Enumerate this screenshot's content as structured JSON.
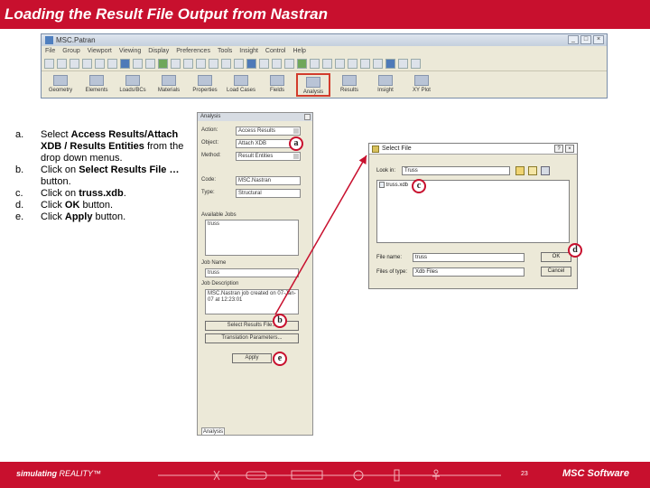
{
  "slide_title": "Loading the Result File Output from Nastran",
  "patran_window": {
    "title": "MSC.Patran",
    "menu": [
      "File",
      "Group",
      "Viewport",
      "Viewing",
      "Display",
      "Preferences",
      "Tools",
      "Insight",
      "Control",
      "Help"
    ],
    "app_buttons": [
      "Geometry",
      "Elements",
      "Loads/BCs",
      "Materials",
      "Properties",
      "Load Cases",
      "Fields",
      "Analysis",
      "Results",
      "Insight",
      "XY Plot"
    ],
    "selected_app": "Analysis",
    "selected_color": "#d23c2c"
  },
  "instructions": [
    {
      "letter": "a.",
      "text_parts": [
        {
          "t": "Select ",
          "b": false
        },
        {
          "t": "Access Results/Attach XDB / Results Entities",
          "b": true
        },
        {
          "t": " from the drop down menus.",
          "b": false
        }
      ]
    },
    {
      "letter": "b.",
      "text_parts": [
        {
          "t": "Click on ",
          "b": false
        },
        {
          "t": "Select Results File …",
          "b": true
        },
        {
          "t": " button.",
          "b": false
        }
      ]
    },
    {
      "letter": "c.",
      "text_parts": [
        {
          "t": "Click on ",
          "b": false
        },
        {
          "t": "truss.xdb",
          "b": true
        },
        {
          "t": ".",
          "b": false
        }
      ]
    },
    {
      "letter": "d.",
      "text_parts": [
        {
          "t": "Click ",
          "b": false
        },
        {
          "t": "OK",
          "b": true
        },
        {
          "t": " button.",
          "b": false
        }
      ]
    },
    {
      "letter": "e.",
      "text_parts": [
        {
          "t": "Click ",
          "b": false
        },
        {
          "t": "Apply",
          "b": true
        },
        {
          "t": " button.",
          "b": false
        }
      ]
    }
  ],
  "analysis_panel": {
    "title": "Analysis",
    "action_label": "Action:",
    "action_value": "Access Results",
    "object_label": "Object:",
    "object_value": "Attach XDB",
    "method_label": "Method:",
    "method_value": "Result Entities",
    "code_label": "Code:",
    "code_value": "MSC.Nastran",
    "type_label": "Type:",
    "type_value": "Structural",
    "available_jobs_label": "Available Jobs",
    "available_jobs": [
      "truss"
    ],
    "job_name_label": "Job Name",
    "job_name_value": "truss",
    "job_desc_label": "Job Description",
    "job_desc_value": "MSC.Nastran job created on 07-Jan-07 at 12:23:01",
    "select_results_button": "Select Results File...",
    "translation_params_button": "Translation Parameters...",
    "apply_button": "Apply",
    "tab_label": "Analysis"
  },
  "select_file_dialog": {
    "title": "Select File",
    "look_in_label": "Look in:",
    "look_in_value": "Truss",
    "files": [
      "truss.xdb"
    ],
    "file_name_label": "File name:",
    "file_name_value": "truss",
    "files_of_type_label": "Files of type:",
    "files_of_type_value": "Xdb Files",
    "ok_button": "OK",
    "cancel_button": "Cancel"
  },
  "callouts": [
    "a",
    "b",
    "c",
    "d",
    "e"
  ],
  "accent_color": "#c8102e",
  "footer": {
    "tagline_bold": "simulating",
    "tagline_rest": " REALITY™",
    "page_number": "23",
    "logo_text": "MSC Software"
  }
}
